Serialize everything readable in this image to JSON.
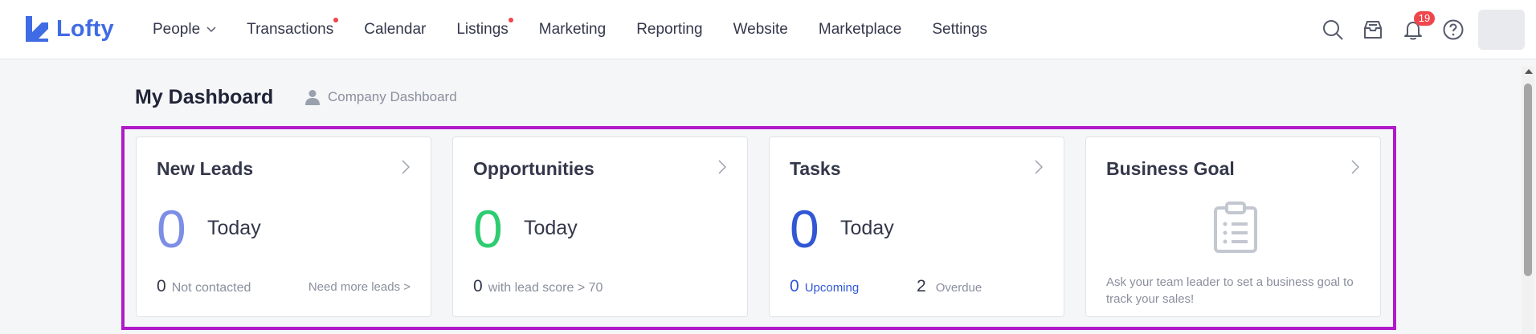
{
  "app": {
    "logo_text": "Lofty"
  },
  "nav": {
    "items": [
      {
        "label": "People",
        "has_dropdown": true,
        "has_dot": false
      },
      {
        "label": "Transactions",
        "has_dropdown": false,
        "has_dot": true
      },
      {
        "label": "Calendar",
        "has_dropdown": false,
        "has_dot": false
      },
      {
        "label": "Listings",
        "has_dropdown": false,
        "has_dot": true
      },
      {
        "label": "Marketing",
        "has_dropdown": false,
        "has_dot": false
      },
      {
        "label": "Reporting",
        "has_dropdown": false,
        "has_dot": false
      },
      {
        "label": "Website",
        "has_dropdown": false,
        "has_dot": false
      },
      {
        "label": "Marketplace",
        "has_dropdown": false,
        "has_dot": false
      },
      {
        "label": "Settings",
        "has_dropdown": false,
        "has_dot": false
      }
    ],
    "notification_count": "19",
    "icons": [
      "search-icon",
      "inbox-icon",
      "bell-icon",
      "help-icon"
    ]
  },
  "header": {
    "title": "My Dashboard",
    "company_link": "Company Dashboard"
  },
  "cards": {
    "new_leads": {
      "title": "New Leads",
      "big_value": "0",
      "period": "Today",
      "footer_value": "0",
      "footer_label": "Not contacted",
      "link": "Need more leads >"
    },
    "opportunities": {
      "title": "Opportunities",
      "big_value": "0",
      "period": "Today",
      "footer_value": "0",
      "footer_label": "with lead score > 70"
    },
    "tasks": {
      "title": "Tasks",
      "big_value": "0",
      "period": "Today",
      "upcoming_value": "0",
      "upcoming_label": "Upcoming",
      "overdue_value": "2",
      "overdue_label": "Overdue"
    },
    "business_goal": {
      "title": "Business Goal",
      "message": "Ask your team leader to set a business goal to track your sales!"
    }
  },
  "colors": {
    "brand": "#3f6be4",
    "leads": "#7c8ee6",
    "opportunities": "#2ecc71",
    "tasks": "#3157d4",
    "highlight": "#b01ac9",
    "badge": "#f0454c"
  }
}
